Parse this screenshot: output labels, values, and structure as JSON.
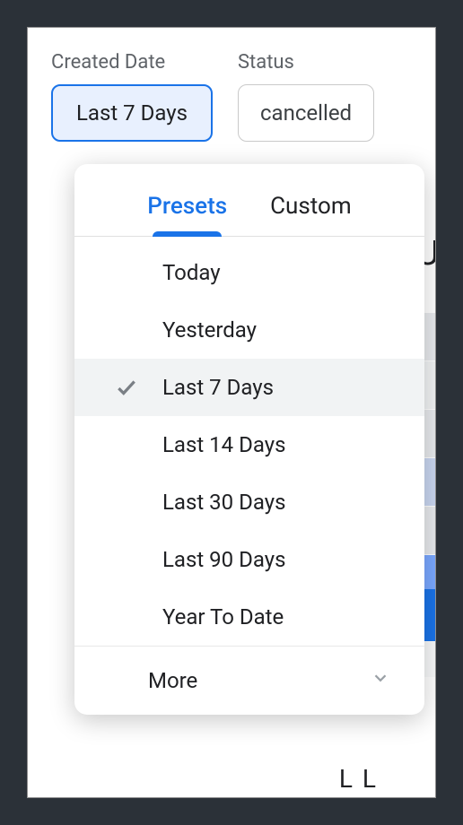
{
  "filters": {
    "createdDate": {
      "label": "Created Date",
      "value": "Last 7 Days"
    },
    "status": {
      "label": "Status",
      "value": "cancelled"
    }
  },
  "dropdown": {
    "tabs": {
      "presets": "Presets",
      "custom": "Custom"
    },
    "options": [
      {
        "label": "Today",
        "selected": false
      },
      {
        "label": "Yesterday",
        "selected": false
      },
      {
        "label": "Last 7 Days",
        "selected": true
      },
      {
        "label": "Last 14 Days",
        "selected": false
      },
      {
        "label": "Last 30 Days",
        "selected": false
      },
      {
        "label": "Last 90 Days",
        "selected": false
      },
      {
        "label": "Year To Date",
        "selected": false
      }
    ],
    "more": "More"
  },
  "background": {
    "letter": "U",
    "bottom": "L L"
  }
}
